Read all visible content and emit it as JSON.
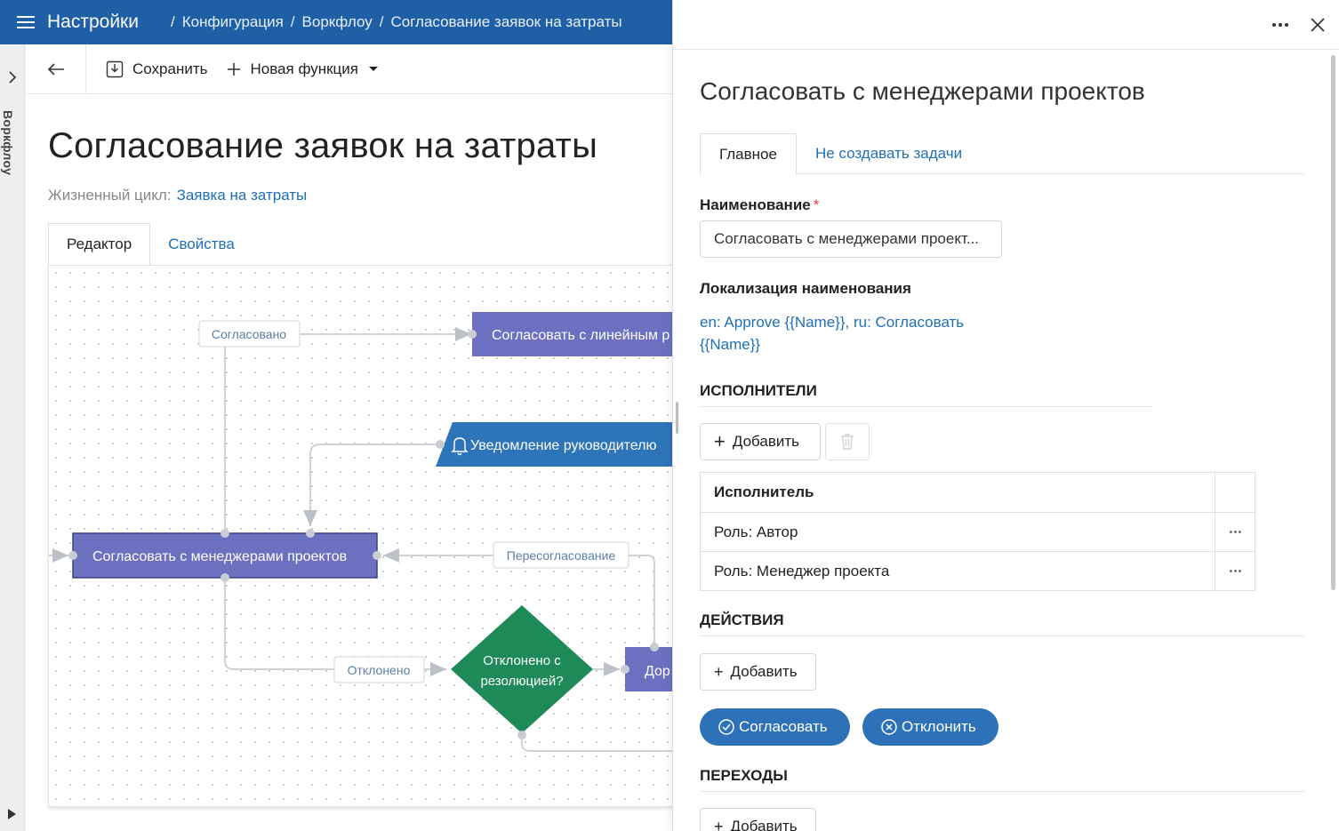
{
  "topbar": {
    "app_title": "Настройки",
    "breadcrumbs": [
      "Конфигурация",
      "Воркфлоу",
      "Согласование заявок на затраты"
    ]
  },
  "left_rail": {
    "label": "Воркфлоу"
  },
  "toolbar": {
    "save_label": "Сохранить",
    "new_function_label": "Новая функция"
  },
  "page": {
    "title": "Согласование заявок на затраты",
    "lifecycle_label": "Жизненный цикл:",
    "lifecycle_value": "Заявка на затраты",
    "tabs": [
      "Редактор",
      "Свойства"
    ]
  },
  "diagram": {
    "nodes": {
      "approve_line": "Согласовать с линейным р",
      "notify_manager": "Уведомление руководителю",
      "approve_pm": "Согласовать с менеджерами проектов",
      "decision_line1": "Отклонено с",
      "decision_line2": "резолюцией?",
      "rework": "Дор"
    },
    "edges": {
      "approved": "Согласовано",
      "reapprove": "Пересогласование",
      "rejected": "Отклонено"
    }
  },
  "panel": {
    "title": "Согласовать с менеджерами проектов",
    "tabs": [
      "Главное",
      "Не создавать задачи"
    ],
    "name_label": "Наименование",
    "required_mark": "*",
    "name_value": "Согласовать с менеджерами проект...",
    "localization_label": "Локализация наименования",
    "localization_value": "en: Approve {{Name}}, ru: Согласовать {{Name}}",
    "executors_header": "ИСПОЛНИТЕЛИ",
    "add_label": "Добавить",
    "executors_table": {
      "column": "Исполнитель",
      "rows": [
        "Роль: Автор",
        "Роль: Менеджер проекта"
      ]
    },
    "actions_header": "ДЕЙСТВИЯ",
    "action_buttons": {
      "approve": "Согласовать",
      "reject": "Отклонить"
    },
    "transitions_header": "ПЕРЕХОДЫ"
  },
  "colors": {
    "topbar": "#1f5fa6",
    "link": "#1f6fb8",
    "task_node": "#6b71c0",
    "notify_node": "#2e74b8",
    "decision_node": "#1d8a57",
    "action_pill": "#2d72b8"
  }
}
